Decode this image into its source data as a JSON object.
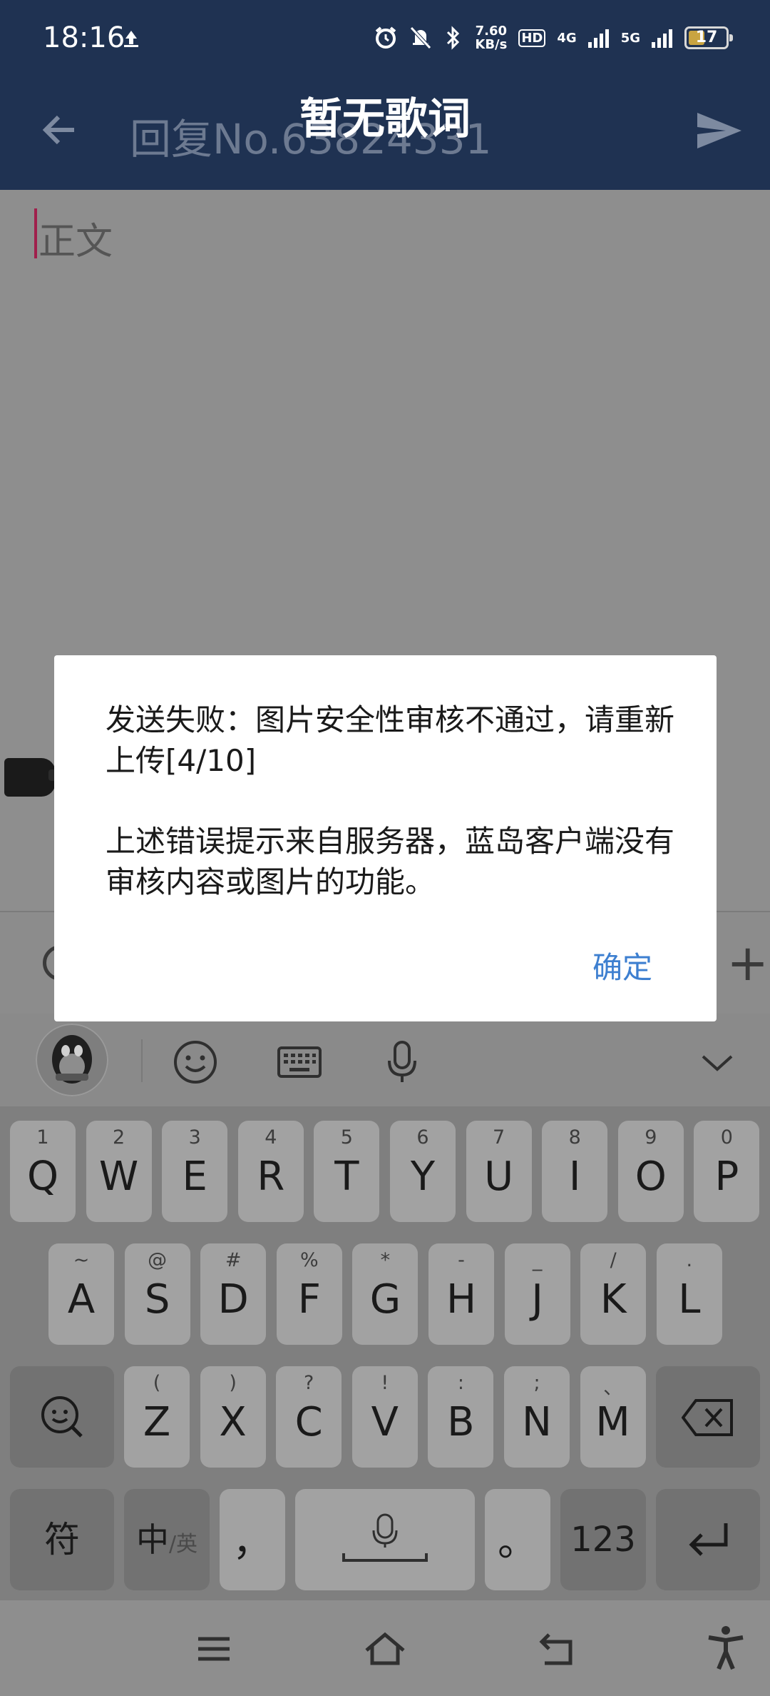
{
  "status_bar": {
    "time": "18:16",
    "net_speed_value": "7.60",
    "net_speed_unit": "KB/s",
    "hd_label": "HD",
    "sim1_network": "4G",
    "sim2_network": "5G",
    "battery_level": "17"
  },
  "app_bar": {
    "title": "回复No.63824331",
    "lyric_overlay": "暂无歌词"
  },
  "editor": {
    "body_placeholder": "正文"
  },
  "dialog": {
    "message_line1": "发送失败：图片安全性审核不通过，请重新上传[4/10]",
    "message_line2": "上述错误提示来自服务器，蓝岛客户端没有审核内容或图片的功能。",
    "confirm_label": "确定"
  },
  "keyboard": {
    "row1": [
      {
        "sub": "1",
        "main": "Q"
      },
      {
        "sub": "2",
        "main": "W"
      },
      {
        "sub": "3",
        "main": "E"
      },
      {
        "sub": "4",
        "main": "R"
      },
      {
        "sub": "5",
        "main": "T"
      },
      {
        "sub": "6",
        "main": "Y"
      },
      {
        "sub": "7",
        "main": "U"
      },
      {
        "sub": "8",
        "main": "I"
      },
      {
        "sub": "9",
        "main": "O"
      },
      {
        "sub": "0",
        "main": "P"
      }
    ],
    "row2": [
      {
        "sub": "~",
        "main": "A"
      },
      {
        "sub": "@",
        "main": "S"
      },
      {
        "sub": "#",
        "main": "D"
      },
      {
        "sub": "%",
        "main": "F"
      },
      {
        "sub": "*",
        "main": "G"
      },
      {
        "sub": "-",
        "main": "H"
      },
      {
        "sub": "_",
        "main": "J"
      },
      {
        "sub": "/",
        "main": "K"
      },
      {
        "sub": ".",
        "main": "L"
      }
    ],
    "row3": [
      {
        "sub": "(",
        "main": "Z"
      },
      {
        "sub": ")",
        "main": "X"
      },
      {
        "sub": "?",
        "main": "C"
      },
      {
        "sub": "!",
        "main": "V"
      },
      {
        "sub": ":",
        "main": "B"
      },
      {
        "sub": ";",
        "main": "N"
      },
      {
        "sub": "、",
        "main": "M"
      }
    ],
    "symbol_key": "符",
    "lang_key_main": "中",
    "lang_key_alt": "/英",
    "comma_key": "，",
    "period_key": "。",
    "numbers_key": "123"
  },
  "icons": {
    "back": "arrow-left-icon",
    "send": "send-icon",
    "emoji": "smiley-icon",
    "keyboard": "keyboard-icon",
    "voice": "microphone-icon",
    "collapse": "chevron-down-icon",
    "backspace": "backspace-icon",
    "enter": "enter-icon",
    "nav_menu": "menu-icon",
    "nav_home": "home-icon",
    "nav_back": "back-icon",
    "accessibility": "accessibility-icon"
  },
  "colors": {
    "app_bar": "#1f3252",
    "dialog_accent": "#3d7fd0",
    "caret": "#a0204c"
  }
}
